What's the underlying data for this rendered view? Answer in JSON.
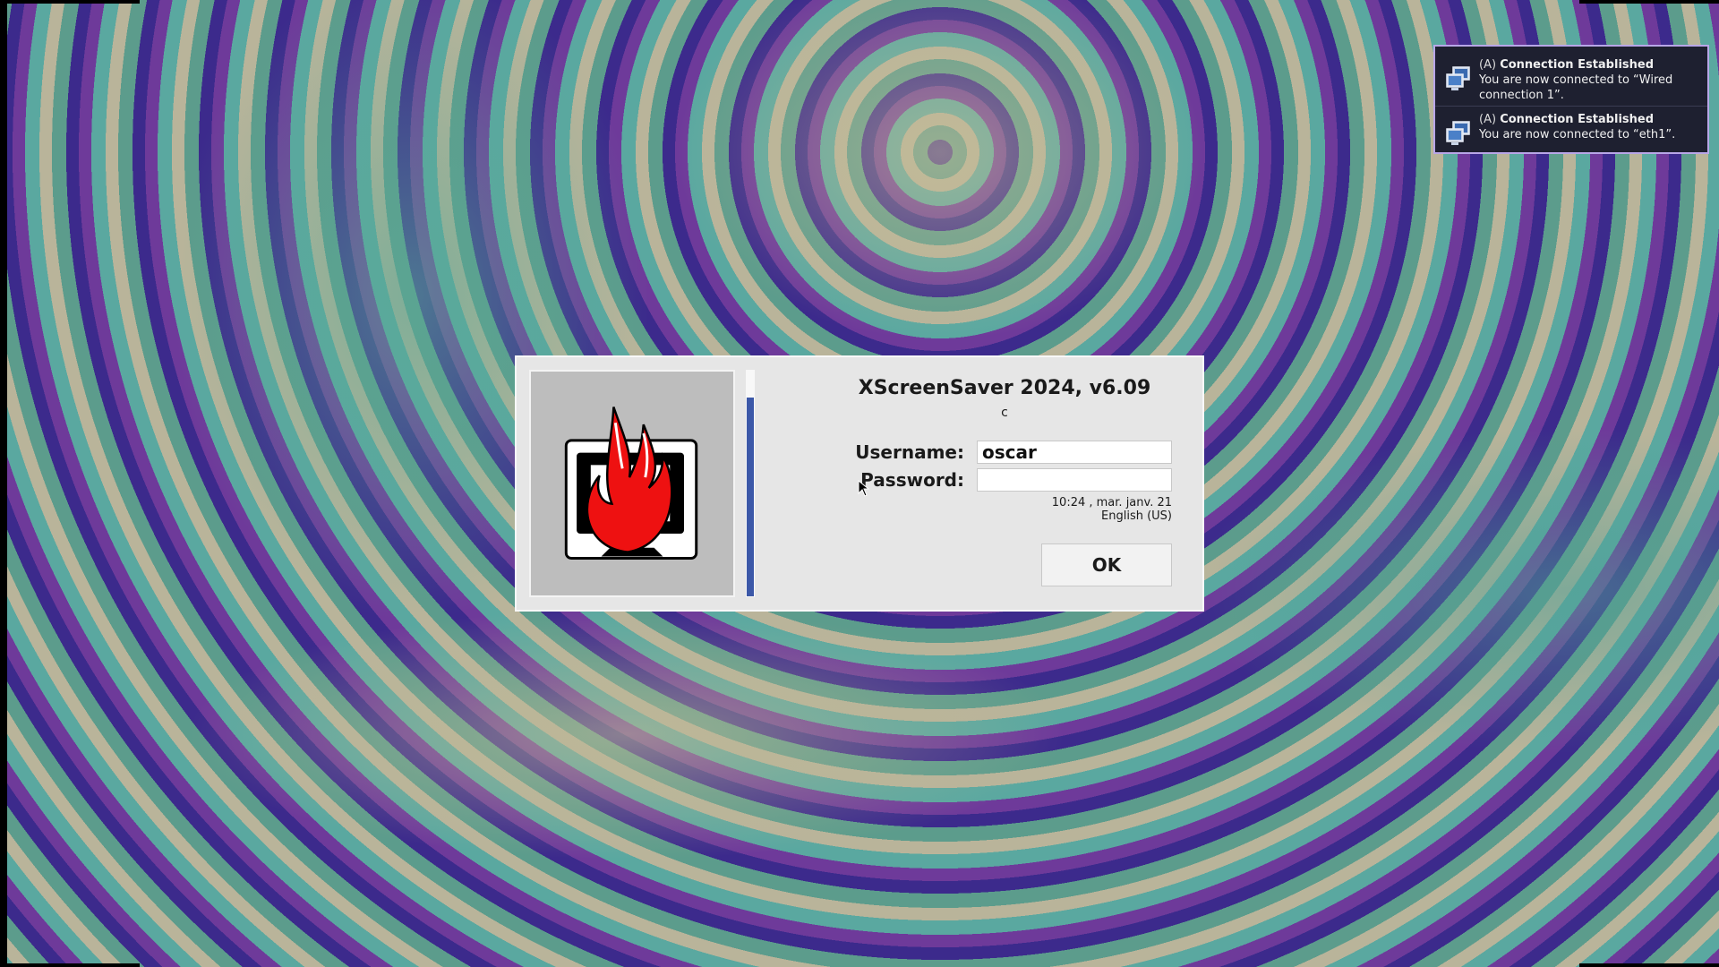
{
  "notifications": [
    {
      "icon": "network-computer-icon",
      "app": "(A)",
      "title": "Connection Established",
      "body_line1": "You are now connected to “Wired",
      "body_line2": "connection 1”."
    },
    {
      "icon": "network-computer-icon",
      "app": "(A)",
      "title": "Connection Established",
      "body_line1": "You are now connected to “eth1”.",
      "body_line2": ""
    }
  ],
  "dialog": {
    "title": "XScreenSaver 2024, v6.09",
    "subtitle": "c",
    "username_label": "Username:",
    "username_value": "oscar",
    "password_label": "Password:",
    "password_value": "",
    "datetime": "10:24 , mar. janv. 21",
    "keyboard_layout": "English (US)",
    "ok_label": "OK",
    "timeout_progress_fraction": 0.88,
    "progress_color": "#3c58a8",
    "logo_icon": "xscreensaver-flaming-monitor-icon"
  }
}
